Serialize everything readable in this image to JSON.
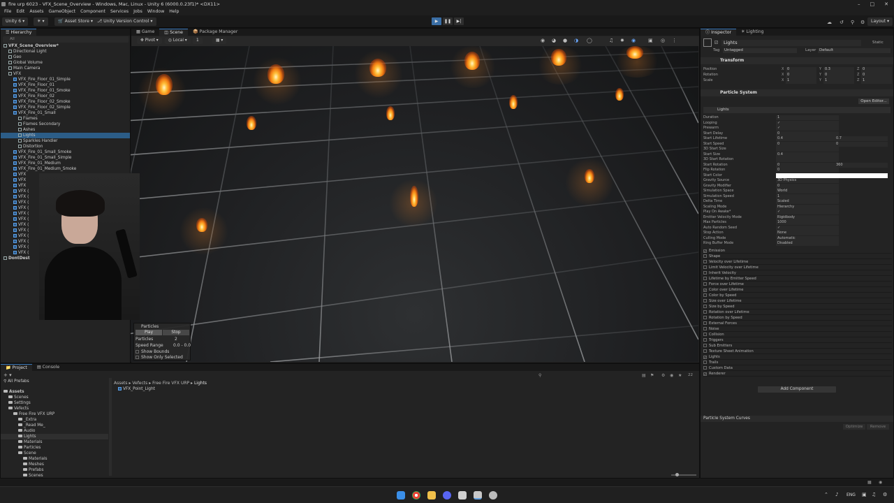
{
  "window": {
    "title": "fire urp 6023 - VFX_Scene_Overview - Windows, Mac, Linux - Unity 6 (6000.0.23f1)* <DX11>"
  },
  "menu": [
    "File",
    "Edit",
    "Assets",
    "GameObject",
    "Component",
    "Services",
    "Jobs",
    "Window",
    "Help"
  ],
  "toolbar": {
    "account": "Unity 6",
    "asset_store": "Asset Store",
    "version_control": "Unity Version Control",
    "layout": "Layout"
  },
  "hierarchy": {
    "tab": "Hierarchy",
    "search_placeholder": "All",
    "rows": [
      {
        "label": "VFX_Scene_Overview*",
        "indent": 0,
        "kind": "scene"
      },
      {
        "label": "Directional Light",
        "indent": 1,
        "kind": "obj"
      },
      {
        "label": "Geo",
        "indent": 1,
        "kind": "obj"
      },
      {
        "label": "Global Volume",
        "indent": 1,
        "kind": "obj"
      },
      {
        "label": "Main Camera",
        "indent": 1,
        "kind": "obj"
      },
      {
        "label": "VFX",
        "indent": 1,
        "kind": "obj"
      },
      {
        "label": "VFX_Fire_Floor_01_Simple",
        "indent": 2,
        "kind": "prefab"
      },
      {
        "label": "VFX_Fire_Floor_01",
        "indent": 2,
        "kind": "prefab"
      },
      {
        "label": "VFX_Fire_Floor_01_Smoke",
        "indent": 2,
        "kind": "prefab"
      },
      {
        "label": "VFX_Fire_Floor_02",
        "indent": 2,
        "kind": "prefab"
      },
      {
        "label": "VFX_Fire_Floor_02_Smoke",
        "indent": 2,
        "kind": "prefab"
      },
      {
        "label": "VFX_Fire_Floor_02_Simple",
        "indent": 2,
        "kind": "prefab"
      },
      {
        "label": "VFX_Fire_01_Small",
        "indent": 2,
        "kind": "prefab"
      },
      {
        "label": "Flames",
        "indent": 3,
        "kind": "obj"
      },
      {
        "label": "Flames Secondary",
        "indent": 3,
        "kind": "obj"
      },
      {
        "label": "Ashes",
        "indent": 3,
        "kind": "obj"
      },
      {
        "label": "Lights",
        "indent": 3,
        "kind": "obj",
        "selected": true
      },
      {
        "label": "Sparkles Handler",
        "indent": 3,
        "kind": "obj"
      },
      {
        "label": "Distortion",
        "indent": 3,
        "kind": "obj"
      },
      {
        "label": "VFX_Fire_01_Small_Smoke",
        "indent": 2,
        "kind": "prefab"
      },
      {
        "label": "VFX_Fire_01_Small_Simple",
        "indent": 2,
        "kind": "prefab"
      },
      {
        "label": "VFX_Fire_01_Medium",
        "indent": 2,
        "kind": "prefab"
      },
      {
        "label": "VFX_Fire_01_Medium_Smoke",
        "indent": 2,
        "kind": "prefab"
      },
      {
        "label": "VFX",
        "indent": 2,
        "kind": "prefab"
      },
      {
        "label": "VFX",
        "indent": 2,
        "kind": "prefab"
      },
      {
        "label": "VFX",
        "indent": 2,
        "kind": "prefab"
      },
      {
        "label": "VFX (",
        "indent": 2,
        "kind": "prefab"
      },
      {
        "label": "VFX (",
        "indent": 2,
        "kind": "prefab"
      },
      {
        "label": "VFX (",
        "indent": 2,
        "kind": "prefab"
      },
      {
        "label": "VFX (",
        "indent": 2,
        "kind": "prefab"
      },
      {
        "label": "VFX (",
        "indent": 2,
        "kind": "prefab"
      },
      {
        "label": "VFX (",
        "indent": 2,
        "kind": "prefab"
      },
      {
        "label": "VFX (",
        "indent": 2,
        "kind": "prefab"
      },
      {
        "label": "VFX (",
        "indent": 2,
        "kind": "prefab"
      },
      {
        "label": "VFX (",
        "indent": 2,
        "kind": "prefab"
      },
      {
        "label": "VFX (",
        "indent": 2,
        "kind": "prefab"
      },
      {
        "label": "VFX (",
        "indent": 2,
        "kind": "prefab"
      },
      {
        "label": "VFX (",
        "indent": 2,
        "kind": "prefab"
      },
      {
        "label": "DontDest",
        "indent": 0,
        "kind": "scene"
      }
    ]
  },
  "scene_tabs": [
    "Game",
    "Scene",
    "Package Manager"
  ],
  "scene_toolbar": {
    "pivot": "Pivot",
    "space": "Local",
    "grid": "1"
  },
  "particles_overlay": {
    "title": "Particles",
    "play": "Play",
    "stop": "Stop",
    "particles_label": "Particles",
    "particles_value": "2",
    "speed_label": "Speed Range",
    "speed_value": "0.0 - 0.0",
    "show_bounds": "Show Bounds",
    "show_only_selected": "Show Only Selected"
  },
  "inspector": {
    "tabs": [
      "Inspector",
      "Lighting"
    ],
    "object_name": "Lights",
    "static_label": "Static",
    "tag_label": "Tag",
    "tag_value": "Untagged",
    "layer_label": "Layer",
    "layer_value": "Default",
    "transform": {
      "title": "Transform",
      "rows": [
        {
          "label": "Position",
          "x": "0",
          "y": "0.3",
          "z": "0"
        },
        {
          "label": "Rotation",
          "x": "0",
          "y": "0",
          "z": "0"
        },
        {
          "label": "Scale",
          "x": "1",
          "y": "1",
          "z": "1"
        }
      ]
    },
    "particle_system": {
      "title": "Particle System",
      "open_editor": "Open Editor...",
      "module_title": "Lights",
      "props": [
        {
          "label": "Duration",
          "value": "1"
        },
        {
          "label": "Looping",
          "value": "✓"
        },
        {
          "label": "Prewarm",
          "value": "✓"
        },
        {
          "label": "Start Delay",
          "value": "0"
        },
        {
          "label": "Start Lifetime",
          "value": "0.4",
          "value2": "0.7"
        },
        {
          "label": "Start Speed",
          "value": "0",
          "value2": "0"
        },
        {
          "label": "3D Start Size",
          "value": ""
        },
        {
          "label": "Start Size",
          "value": "0.4"
        },
        {
          "label": "3D Start Rotation",
          "value": ""
        },
        {
          "label": "Start Rotation",
          "value": "0",
          "value2": "360"
        },
        {
          "label": "Flip Rotation",
          "value": "0"
        },
        {
          "label": "Start Color",
          "value": ""
        },
        {
          "label": "Gravity Source",
          "value": "3D Physics"
        },
        {
          "label": "Gravity Modifier",
          "value": "0"
        },
        {
          "label": "Simulation Space",
          "value": "World"
        },
        {
          "label": "Simulation Speed",
          "value": "1"
        },
        {
          "label": "Delta Time",
          "value": "Scaled"
        },
        {
          "label": "Scaling Mode",
          "value": "Hierarchy"
        },
        {
          "label": "Play On Awake*",
          "value": "✓"
        },
        {
          "label": "Emitter Velocity Mode",
          "value": "Rigidbody"
        },
        {
          "label": "Max Particles",
          "value": "1000"
        },
        {
          "label": "Auto Random Seed",
          "value": "✓"
        },
        {
          "label": "Stop Action",
          "value": "None"
        },
        {
          "label": "Culling Mode",
          "value": "Automatic"
        },
        {
          "label": "Ring Buffer Mode",
          "value": "Disabled"
        }
      ],
      "modules": [
        {
          "label": "Emission",
          "on": true
        },
        {
          "label": "Shape",
          "on": false
        },
        {
          "label": "Velocity over Lifetime",
          "on": false
        },
        {
          "label": "Limit Velocity over Lifetime",
          "on": false
        },
        {
          "label": "Inherit Velocity",
          "on": false
        },
        {
          "label": "Lifetime by Emitter Speed",
          "on": false
        },
        {
          "label": "Force over Lifetime",
          "on": false
        },
        {
          "label": "Color over Lifetime",
          "on": true
        },
        {
          "label": "Color by Speed",
          "on": false
        },
        {
          "label": "Size over Lifetime",
          "on": false
        },
        {
          "label": "Size by Speed",
          "on": false
        },
        {
          "label": "Rotation over Lifetime",
          "on": false
        },
        {
          "label": "Rotation by Speed",
          "on": false
        },
        {
          "label": "External Forces",
          "on": false
        },
        {
          "label": "Noise",
          "on": false
        },
        {
          "label": "Collision",
          "on": false
        },
        {
          "label": "Triggers",
          "on": false
        },
        {
          "label": "Sub Emitters",
          "on": false
        },
        {
          "label": "Texture Sheet Animation",
          "on": false
        },
        {
          "label": "Lights",
          "on": true
        },
        {
          "label": "Trails",
          "on": false
        },
        {
          "label": "Custom Data",
          "on": false
        },
        {
          "label": "Renderer",
          "on": true
        }
      ]
    },
    "add_component": "Add Component",
    "curves_title": "Particle System Curves",
    "optimize": "Optimize",
    "remove": "Remove"
  },
  "project": {
    "tabs": [
      "Project",
      "Console"
    ],
    "favorites": "All Prefabs",
    "breadcrumb": [
      "Assets",
      "Vefects",
      "Free Fire VFX URP",
      "Lights"
    ],
    "tree": [
      {
        "label": "Assets",
        "indent": 0,
        "bold": true
      },
      {
        "label": "Scenes",
        "indent": 1
      },
      {
        "label": "Settings",
        "indent": 1
      },
      {
        "label": "Vefects",
        "indent": 1
      },
      {
        "label": "Free Fire VFX URP",
        "indent": 2
      },
      {
        "label": "_Extra",
        "indent": 3
      },
      {
        "label": "_Read Me_",
        "indent": 3
      },
      {
        "label": "Audio",
        "indent": 3
      },
      {
        "label": "Lights",
        "indent": 3,
        "selected": true
      },
      {
        "label": "Materials",
        "indent": 3
      },
      {
        "label": "Particles",
        "indent": 3
      },
      {
        "label": "Scene",
        "indent": 3
      },
      {
        "label": "Materials",
        "indent": 4
      },
      {
        "label": "Meshes",
        "indent": 4
      },
      {
        "label": "Prefabs",
        "indent": 4
      },
      {
        "label": "Scenes",
        "indent": 4
      }
    ],
    "asset": "VFX_Point_Light",
    "count": "22"
  },
  "taskbar": {
    "lang": "ENG"
  },
  "colors": {
    "selection": "#2c5d87",
    "accent": "#3a79bb",
    "fire": "#f07a12"
  }
}
